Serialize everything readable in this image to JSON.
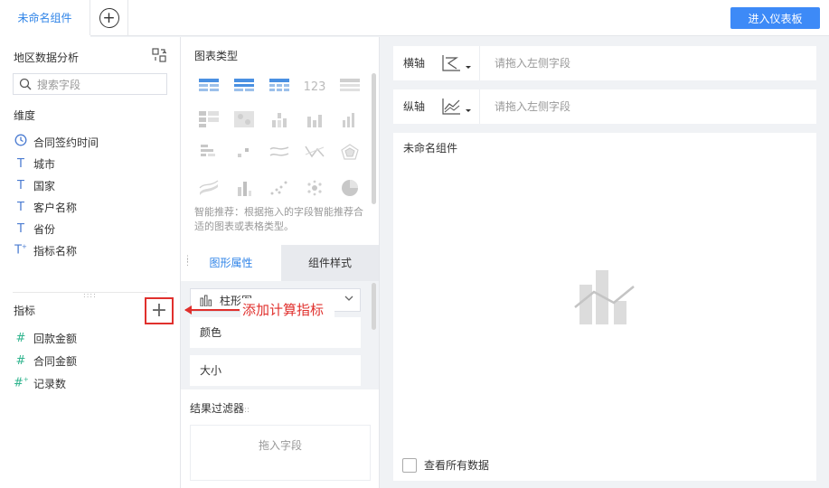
{
  "header": {
    "tab_label": "未命名组件",
    "add_tab_symbol": "+",
    "enter_dashboard_label": "进入仪表板"
  },
  "left_panel": {
    "dataset_title": "地区数据分析",
    "search_placeholder": "搜索字段",
    "dimensions_label": "维度",
    "dimensions": [
      {
        "icon": "clock-icon",
        "label": "合同签约时间"
      },
      {
        "icon": "text-field-icon",
        "label": "城市"
      },
      {
        "icon": "text-field-icon",
        "label": "国家"
      },
      {
        "icon": "text-field-icon",
        "label": "客户名称"
      },
      {
        "icon": "text-field-icon",
        "label": "省份"
      },
      {
        "icon": "text-calc-field-icon",
        "label": "指标名称"
      }
    ],
    "measures_label": "指标",
    "add_measure_symbol": "+",
    "measures": [
      {
        "icon": "number-field-icon",
        "label": "回款金额"
      },
      {
        "icon": "number-field-icon",
        "label": "合同金额"
      },
      {
        "icon": "number-calc-field-icon",
        "label": "记录数"
      }
    ]
  },
  "middle_panel": {
    "chart_type_title": "图表类型",
    "chart_types": [
      "table-chart-icon",
      "cross-table-icon",
      "detail-table-icon",
      "kpi-number-icon",
      "text-chart-icon",
      "grouped-table-icon",
      "heatmap-icon",
      "stacked-column-icon",
      "column-chart-icon",
      "multi-column-icon",
      "bar-chart-icon",
      "scatter-small-icon",
      "line-chart-icon",
      "range-line-icon",
      "radar-chart-icon",
      "area-chart-icon",
      "stacked-bar-icon",
      "scatter-chart-icon",
      "bubble-chart-icon",
      "pie-chart-icon"
    ],
    "kpi_label": "123",
    "hint_text": "智能推荐：根据拖入的字段智能推荐合适的图表或表格类型。",
    "tab_graph_label": "图形属性",
    "tab_style_label": "组件样式",
    "chart_type_select_label": "柱形图",
    "prop_color_label": "颜色",
    "prop_size_label": "大小",
    "filter_title": "结果过滤器",
    "filter_drop_text": "拖入字段"
  },
  "annotation": {
    "text": "添加计算指标"
  },
  "right_panel": {
    "x_axis_label": "横轴",
    "x_axis_placeholder": "请拖入左侧字段",
    "y_axis_label": "纵轴",
    "y_axis_placeholder": "请拖入左侧字段",
    "canvas_title": "未命名组件",
    "view_all_label": "查看所有数据"
  },
  "colors": {
    "accent": "#3d8af7",
    "highlight_red": "#e0302d",
    "dimension_icon": "#4a7bd1",
    "measure_icon": "#30b48e"
  }
}
